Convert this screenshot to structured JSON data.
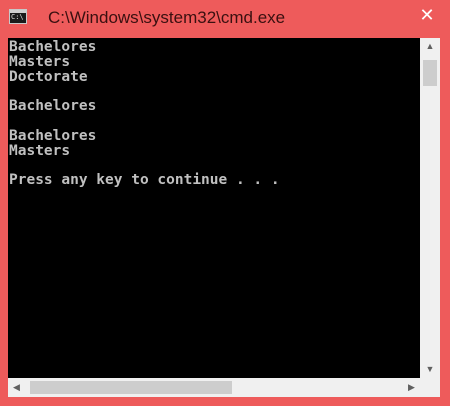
{
  "window": {
    "title": "C:\\Windows\\system32\\cmd.exe",
    "icon_name": "cmd-icon",
    "icon_text": "C:\\",
    "close_label": "✕",
    "frame_color": "#ee5b5b"
  },
  "console": {
    "text": "Bachelores\nMasters\nDoctorate\n\nBachelores\n\nBachelores\nMasters\n\nPress any key to continue . . .",
    "background": "#000000",
    "foreground": "#c0c0c0"
  },
  "scrollbars": {
    "up_glyph": "▲",
    "down_glyph": "▼",
    "left_glyph": "◀",
    "right_glyph": "▶"
  }
}
